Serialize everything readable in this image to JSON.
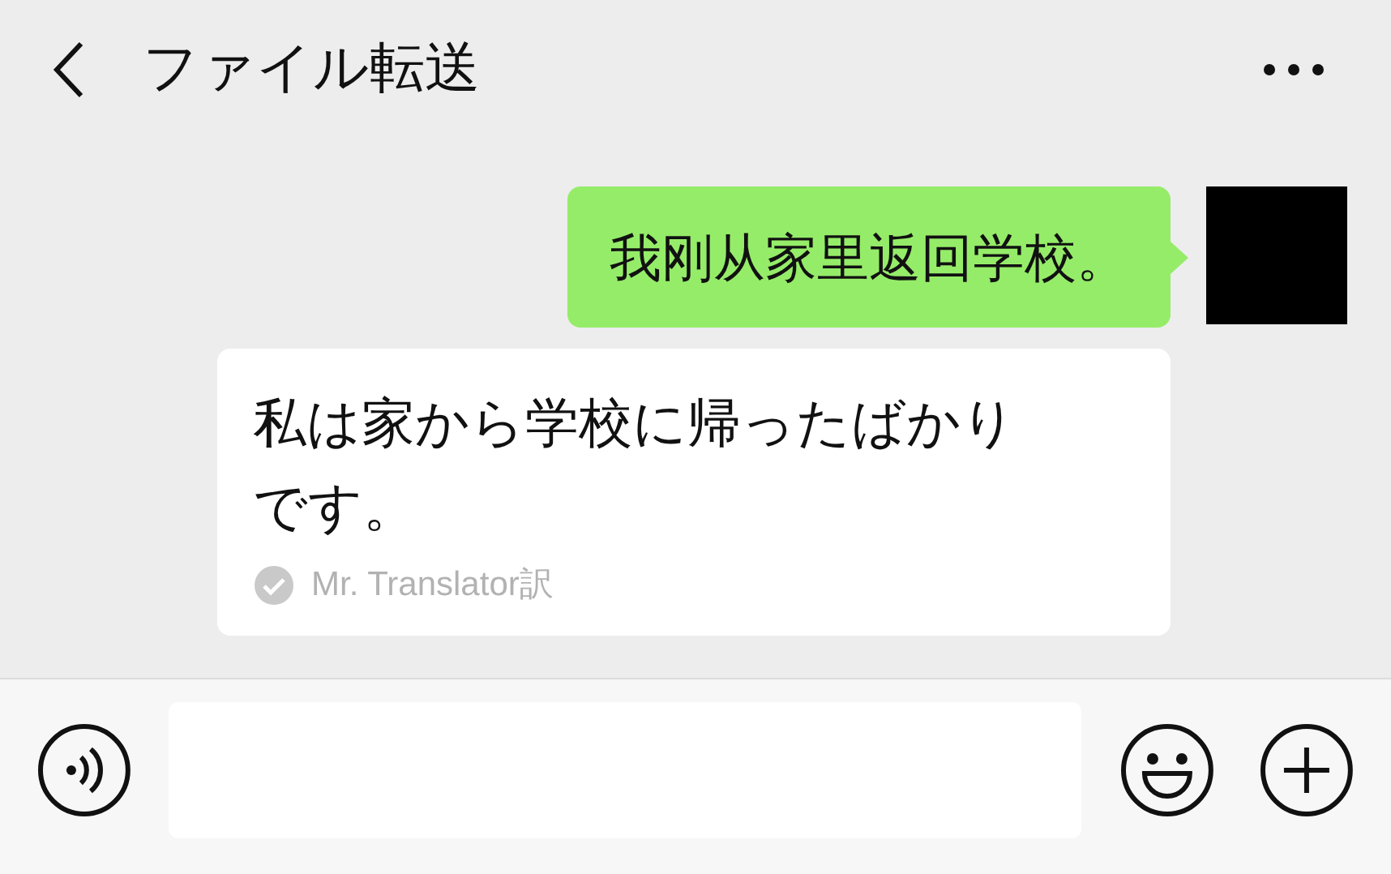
{
  "header": {
    "title": "ファイル転送"
  },
  "messages": [
    {
      "kind": "sent",
      "text": "我刚从家里返回学校。"
    },
    {
      "kind": "translation",
      "lines": [
        "私は家から学校に帰ったばかり",
        "です。"
      ],
      "credit": "Mr. Translator訳"
    }
  ]
}
